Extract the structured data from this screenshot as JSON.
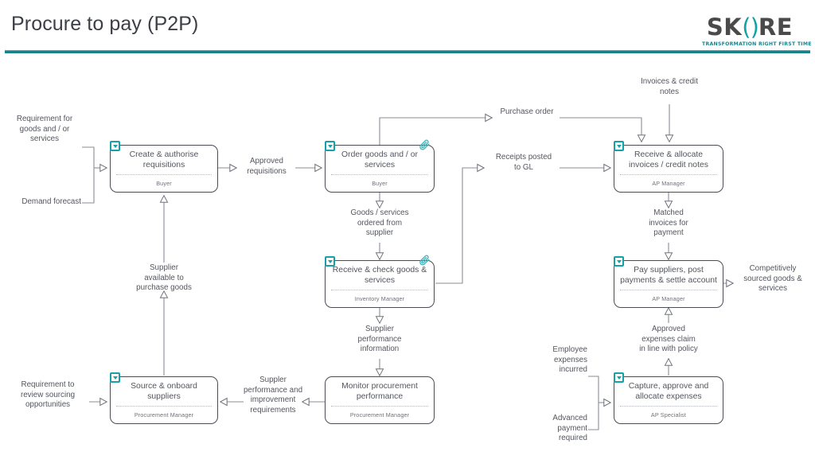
{
  "header": {
    "title": "Procure to pay (P2P)",
    "rule_color": "#18838a"
  },
  "logo": {
    "word_left": "SK",
    "word_parens": "()",
    "word_right": "RE",
    "tagline": "TRANSFORMATION RIGHT FIRST TIME",
    "accent_color": "#16a0a8",
    "text_color": "#4a4a4a"
  },
  "diagram": {
    "type": "process-flow",
    "accent_color": "#16a0a8",
    "box_border_color": "#4a4d55",
    "text_color": "#53565f",
    "boxes": [
      {
        "id": "create-authorise-requisitions",
        "title": "Create & authorise requisitions",
        "role": "Buyer",
        "has_dropdown_badge": true,
        "has_attachment_badge": false
      },
      {
        "id": "order-goods-services",
        "title": "Order goods and / or services",
        "role": "Buyer",
        "has_dropdown_badge": true,
        "has_attachment_badge": true
      },
      {
        "id": "receive-allocate-invoices",
        "title": "Receive & allocate invoices / credit notes",
        "role": "AP Manager",
        "has_dropdown_badge": true,
        "has_attachment_badge": false
      },
      {
        "id": "receive-check-goods",
        "title": "Receive & check goods & services",
        "role": "Inventory Manager",
        "has_dropdown_badge": true,
        "has_attachment_badge": true
      },
      {
        "id": "pay-suppliers",
        "title": "Pay suppliers, post payments & settle account",
        "role": "AP Manager",
        "has_dropdown_badge": true,
        "has_attachment_badge": false
      },
      {
        "id": "source-onboard-suppliers",
        "title": "Source & onboard suppliers",
        "role": "Procurement Manager",
        "has_dropdown_badge": true,
        "has_attachment_badge": false
      },
      {
        "id": "monitor-procurement-performance",
        "title": "Monitor procurement performance",
        "role": "Procurement Manager",
        "has_dropdown_badge": false,
        "has_attachment_badge": false
      },
      {
        "id": "capture-approve-allocate-expenses",
        "title": "Capture, approve and allocate expenses",
        "role": "AP Specialist",
        "has_dropdown_badge": true,
        "has_attachment_badge": false
      }
    ],
    "flow_labels": [
      {
        "id": "requirement-goods-services",
        "text": "Requirement for\ngoods and / or\nservices"
      },
      {
        "id": "demand-forecast",
        "text": "Demand forecast"
      },
      {
        "id": "approved-requisitions",
        "text": "Approved\nrequisitions"
      },
      {
        "id": "purchase-order",
        "text": "Purchase order"
      },
      {
        "id": "invoices-credit-notes",
        "text": "Invoices & credit\nnotes"
      },
      {
        "id": "receipts-posted-to-gl",
        "text": "Receipts posted\nto GL"
      },
      {
        "id": "goods-services-ordered",
        "text": "Goods / services\nordered from\nsupplier"
      },
      {
        "id": "matched-invoices",
        "text": "Matched\ninvoices for\npayment"
      },
      {
        "id": "supplier-available",
        "text": "Supplier\navailable to\npurchase goods"
      },
      {
        "id": "supplier-performance-info",
        "text": "Supplier\nperformance\ninformation"
      },
      {
        "id": "approved-expenses-claim",
        "text": "Approved\nexpenses claim\nin line with policy"
      },
      {
        "id": "competitively-sourced",
        "text": "Competitively\nsourced goods &\nservices"
      },
      {
        "id": "requirement-review-sourcing",
        "text": "Requirement to\nreview sourcing\nopportunities"
      },
      {
        "id": "suppler-performance-improvement",
        "text": "Suppler\nperformance and\nimprovement\nrequirements"
      },
      {
        "id": "employee-expenses-incurred",
        "text": "Employee\nexpenses\nincurred"
      },
      {
        "id": "advanced-payment-required",
        "text": "Advanced\npayment\nrequired"
      }
    ]
  }
}
